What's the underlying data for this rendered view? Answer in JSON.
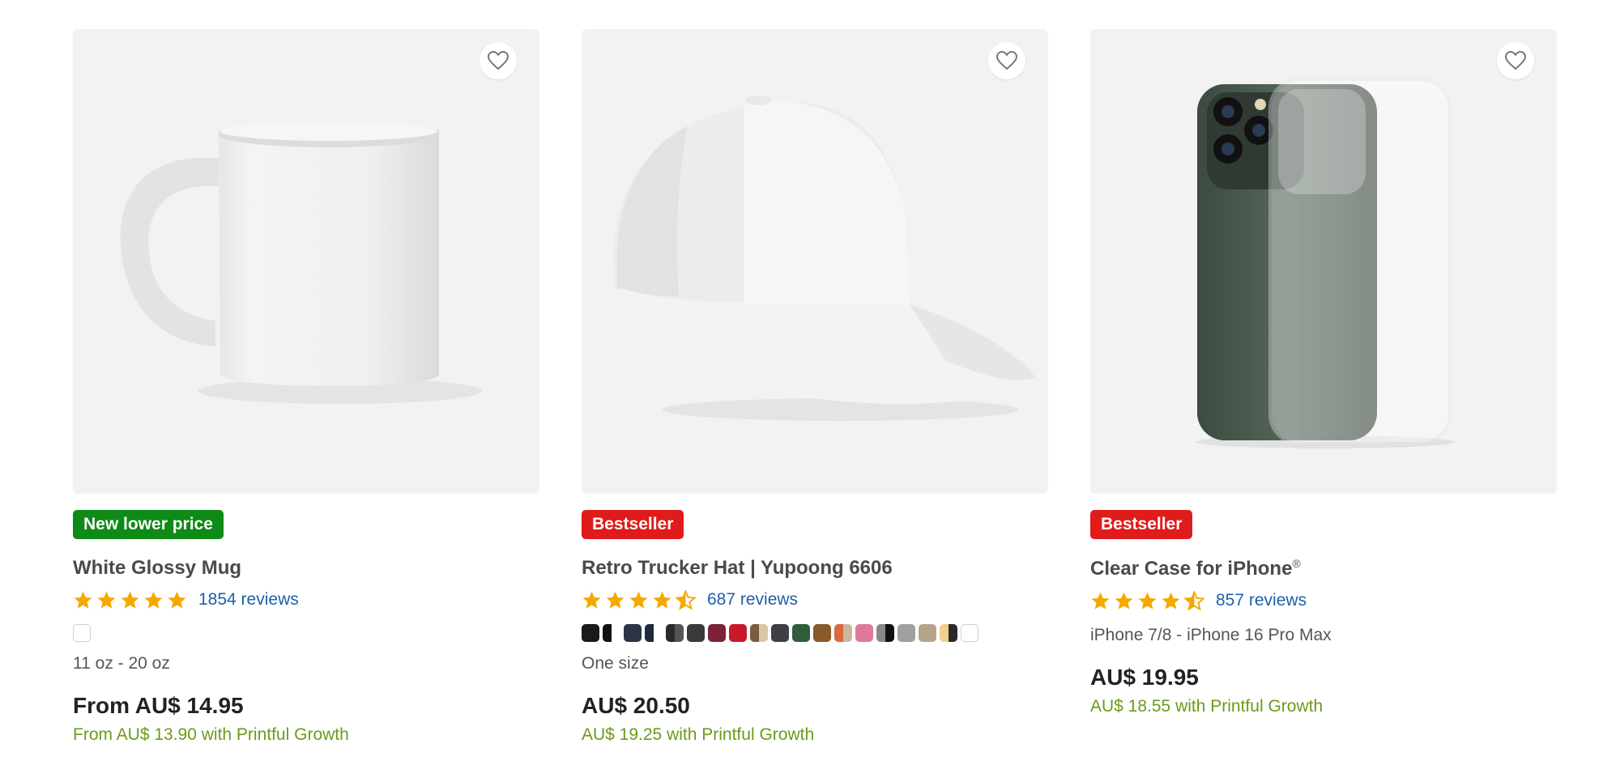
{
  "products": [
    {
      "badge": "New lower price",
      "badge_color": "#0e8a16",
      "title": "White Glossy Mug",
      "title_suffix": "",
      "rating": 5,
      "reviews": "1854 reviews",
      "variant": "11 oz - 20 oz",
      "price": "From AU$ 14.95",
      "growth_price": "From AU$ 13.90 with Printful Growth",
      "image_icon": "white-mug",
      "swatches": [
        "#ffffff"
      ]
    },
    {
      "badge": "Bestseller",
      "badge_color": "#e01b1b",
      "title": "Retro Trucker Hat | Yupoong 6606",
      "title_suffix": "",
      "rating": 4.5,
      "reviews": "687 reviews",
      "variant": "One size",
      "price": "AU$ 20.50",
      "growth_price": "AU$ 19.25 with Printful Growth",
      "image_icon": "trucker-hat",
      "swatches": [
        "#1a1a1a",
        "#111111|#ffffff",
        "#2b3442",
        "#1f2a3a|#ffffff",
        "#2a2a2a|#555555",
        "#3a3a3a",
        "#7b2236",
        "#c8192b",
        "#7a5c3e|#d8c7a8",
        "#3f4045",
        "#2f5e3a",
        "#8a5a2a",
        "#d86a3c|#c9b7a0",
        "#e07a9a",
        "#888888|#111111",
        "#a0a0a0",
        "#b5a48a",
        "#f2d08a|#2a2a2a",
        "#ffffff"
      ]
    },
    {
      "badge": "Bestseller",
      "badge_color": "#e01b1b",
      "title": "Clear Case for iPhone",
      "title_suffix": "®",
      "rating": 4.5,
      "reviews": "857 reviews",
      "variant": "iPhone 7/8 - iPhone 16 Pro Max",
      "price": "AU$ 19.95",
      "growth_price": "AU$ 18.55 with Printful Growth",
      "image_icon": "iphone-clear-case",
      "swatches": []
    }
  ]
}
